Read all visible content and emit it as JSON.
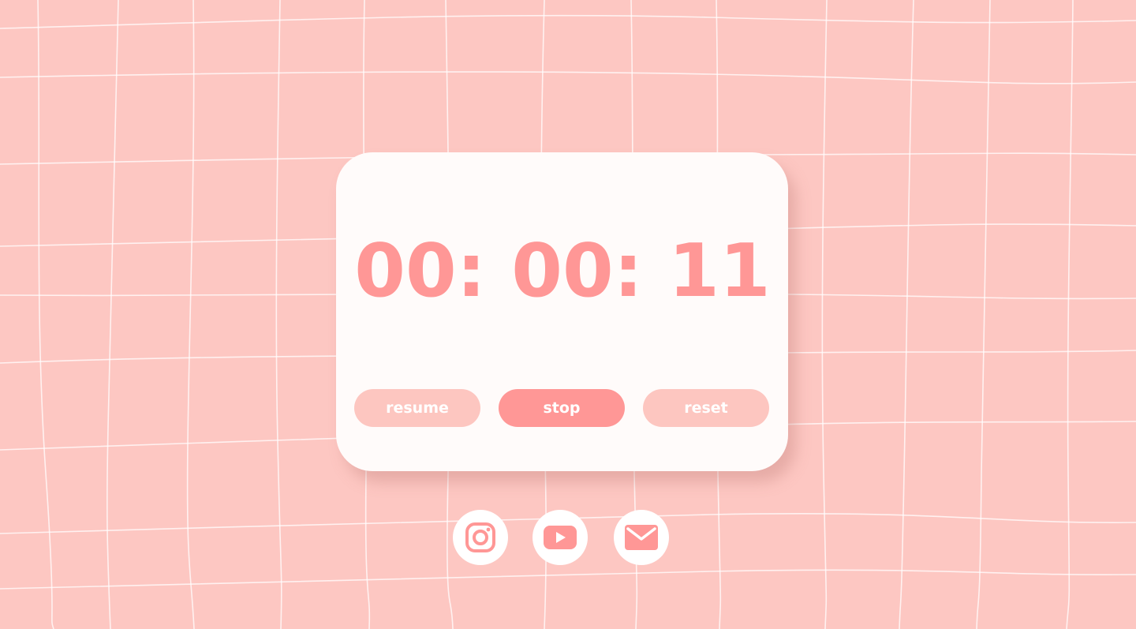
{
  "timer": {
    "display": "00: 00: 11",
    "hours": "00",
    "minutes": "00",
    "seconds": "11"
  },
  "controls": {
    "resume_label": "resume",
    "stop_label": "stop",
    "reset_label": "reset"
  },
  "social": [
    {
      "name": "instagram",
      "icon": "instagram-icon"
    },
    {
      "name": "youtube",
      "icon": "youtube-icon"
    },
    {
      "name": "email",
      "icon": "mail-icon"
    }
  ],
  "colors": {
    "background": "#fdc7c2",
    "grid_lines": "#ffffff",
    "card": "#fffbfa",
    "accent": "#ff9796",
    "button_muted": "#fdc6c0",
    "button_text": "#ffffff",
    "social_bg": "#ffffff"
  }
}
